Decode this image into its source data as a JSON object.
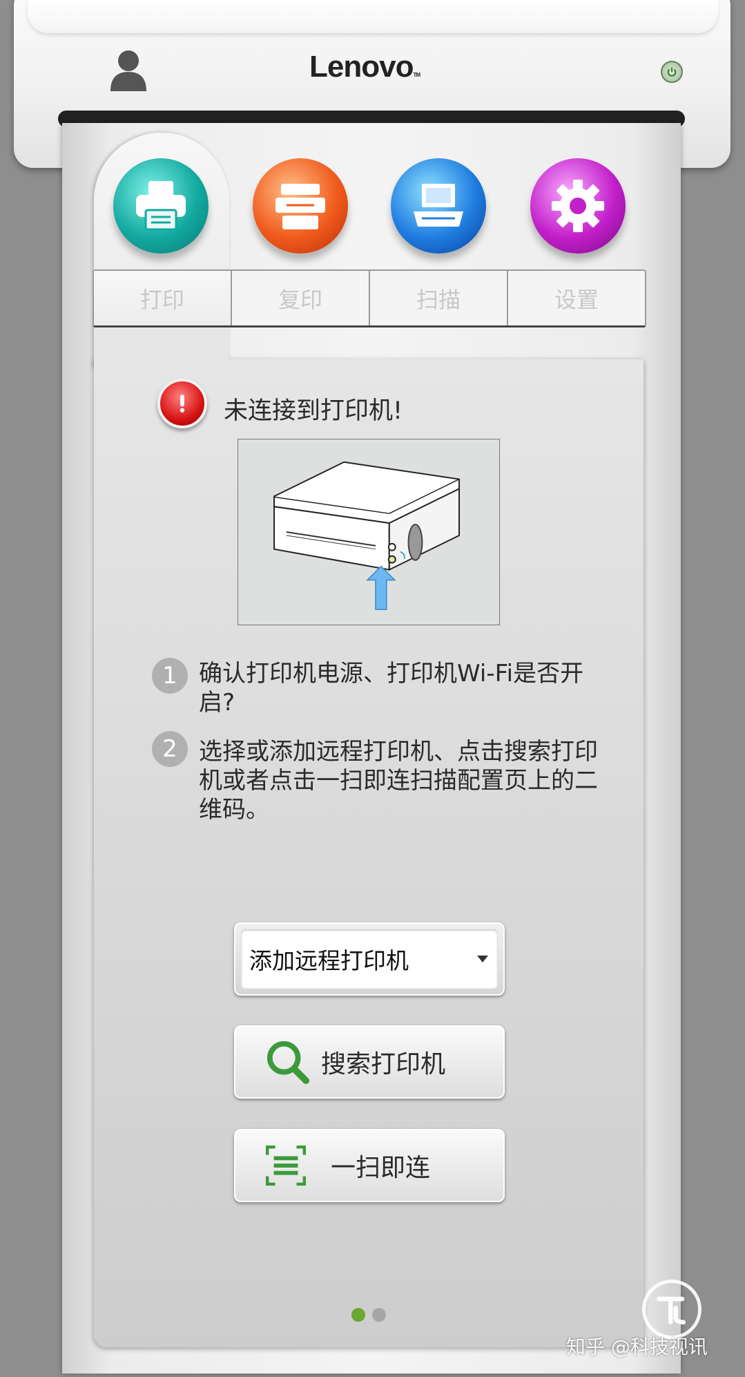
{
  "header": {
    "brand": "Lenovo",
    "brand_tm": "TM",
    "user_icon": "user-icon",
    "power_icon": "power-icon"
  },
  "tabs": [
    {
      "label": "打印",
      "icon": "printer-icon",
      "color": "#1db8b0"
    },
    {
      "label": "复印",
      "icon": "copier-icon",
      "color": "#f05a1c"
    },
    {
      "label": "扫描",
      "icon": "scanner-icon",
      "color": "#1f7de0"
    },
    {
      "label": "设置",
      "icon": "gear-icon",
      "color": "#c21fc9"
    }
  ],
  "alert": {
    "icon": "warning-icon",
    "text": "未连接到打印机!"
  },
  "steps": [
    {
      "num": "1",
      "text": "确认打印机电源、打印机Wi-Fi是否开启?"
    },
    {
      "num": "2",
      "text": "选择或添加远程打印机、点击搜索打印机或者点击一扫即连扫描配置页上的二维码。"
    }
  ],
  "select": {
    "value": "添加远程打印机"
  },
  "buttons": {
    "search": "搜索打印机",
    "scan_connect": "一扫即连"
  },
  "pager": {
    "active": 1,
    "total": 2,
    "active_color": "#6aa832"
  },
  "watermark": {
    "text": "知乎 @科技视讯"
  }
}
